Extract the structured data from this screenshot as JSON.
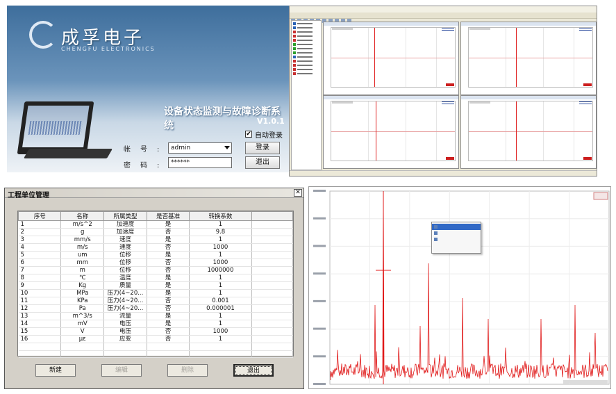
{
  "login": {
    "logo_text": "成孚电子",
    "logo_subtext": "CHENGFU ELECTRONICS",
    "system_title": "设备状态监测与故障诊断系统",
    "version": "V1.0.1",
    "account_label": "帐号:",
    "account_value": "admin",
    "password_label": "密码:",
    "password_value": "******",
    "auto_login_label": "自动登录",
    "auto_login_checked": true,
    "login_button": "登录",
    "exit_button": "退出"
  },
  "unit_dialog": {
    "title": "工程单位管理",
    "close_glyph": "✕",
    "columns": [
      "序号",
      "名称",
      "所属类型",
      "是否基准",
      "转换系数"
    ],
    "rows": [
      [
        "1",
        "m/s^2",
        "加速度",
        "是",
        "1"
      ],
      [
        "2",
        "g",
        "加速度",
        "否",
        "9.8"
      ],
      [
        "3",
        "mm/s",
        "速度",
        "是",
        "1"
      ],
      [
        "4",
        "m/s",
        "速度",
        "否",
        "1000"
      ],
      [
        "5",
        "um",
        "位移",
        "是",
        "1"
      ],
      [
        "6",
        "mm",
        "位移",
        "否",
        "1000"
      ],
      [
        "7",
        "m",
        "位移",
        "否",
        "1000000"
      ],
      [
        "8",
        "℃",
        "温度",
        "是",
        "1"
      ],
      [
        "9",
        "Kg",
        "质量",
        "是",
        "1"
      ],
      [
        "10",
        "MPa",
        "压力(4~20...",
        "是",
        "1"
      ],
      [
        "11",
        "KPa",
        "压力(4~20...",
        "否",
        "0.001"
      ],
      [
        "12",
        "Pa",
        "压力(4~20...",
        "否",
        "0.000001"
      ],
      [
        "13",
        "m^3/s",
        "流量",
        "是",
        "1"
      ],
      [
        "14",
        "mV",
        "电压",
        "是",
        "1"
      ],
      [
        "15",
        "V",
        "电压",
        "否",
        "1000"
      ],
      [
        "16",
        "με",
        "应变",
        "否",
        "1"
      ]
    ],
    "buttons": {
      "new": "新建",
      "edit": "编辑",
      "delete": "删除",
      "exit": "退出"
    }
  },
  "colors": {
    "trace_red": "#e01818",
    "selection_blue": "#3169c6",
    "dialog_gray": "#d4d0c8"
  }
}
